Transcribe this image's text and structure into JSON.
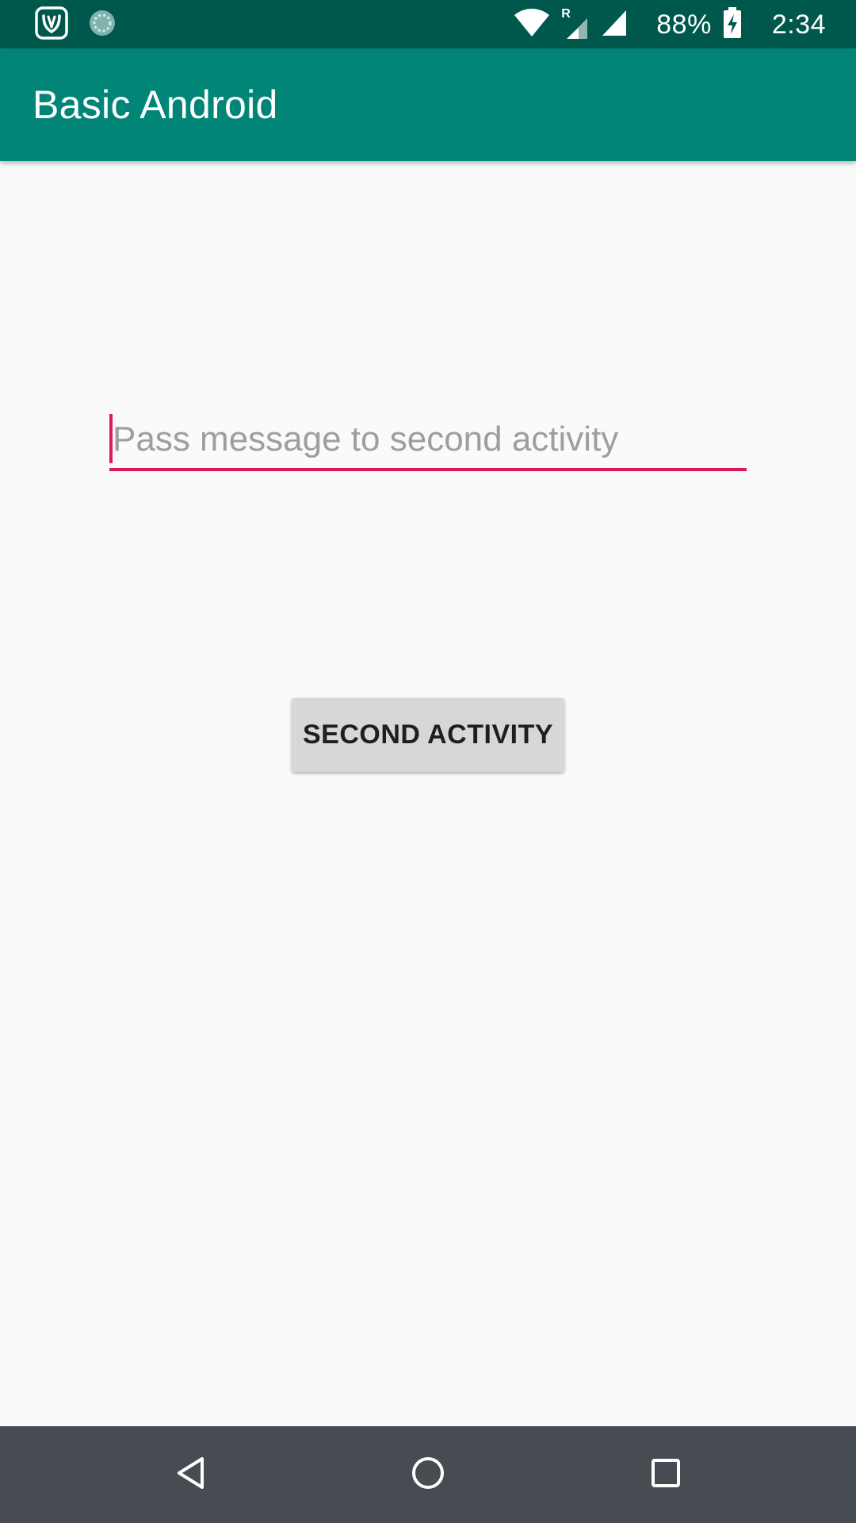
{
  "status_bar": {
    "battery_percent": "88%",
    "clock": "2:34",
    "signal_roaming_mark": "R",
    "left_icons": [
      "app-notification-icon",
      "sync-notification-icon"
    ],
    "right_icons": [
      "wifi-icon",
      "cell-signal-roaming-icon",
      "cell-signal-icon",
      "battery-charging-icon"
    ],
    "background_color": "#00574b"
  },
  "app_bar": {
    "title": "Basic Android",
    "background_color": "#008577"
  },
  "main": {
    "message_input": {
      "value": "",
      "placeholder": "Pass message to second activity",
      "accent_color": "#d81b60"
    },
    "second_activity_button": {
      "label": "SECOND ACTIVITY",
      "background_color": "#d6d7d7"
    }
  },
  "nav_bar": {
    "buttons": [
      "back-icon",
      "home-icon",
      "recents-icon"
    ],
    "background_color": "#464c52"
  }
}
